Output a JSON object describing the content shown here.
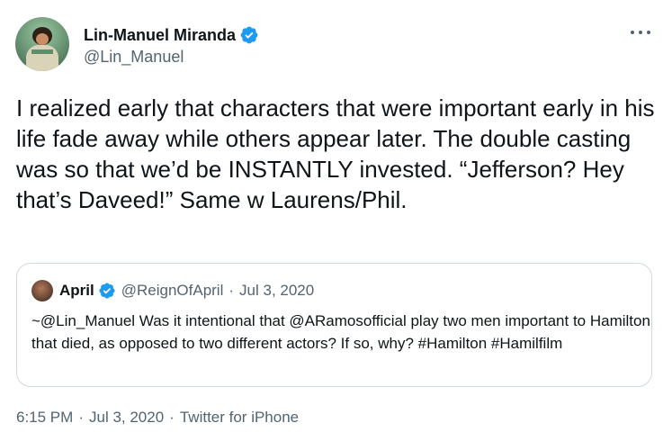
{
  "author": {
    "display_name": "Lin-Manuel Miranda",
    "handle": "@Lin_Manuel",
    "verified_icon": "verified-badge-icon"
  },
  "tweet": {
    "text": "I realized early that characters that were important early in his life fade away while others appear later. The double casting was so that we’d be INSTANTLY invested. “Jefferson? Hey that’s Daveed!” Same w Laurens/Phil."
  },
  "quoted_tweet": {
    "display_name": "April",
    "handle": "@ReignOfApril",
    "separator": "·",
    "date": "Jul 3, 2020",
    "text": "~@Lin_Manuel Was it intentional that @ARamosofficial play two men important to Hamilton that died, as opposed to two different actors? If so, why? #Hamilton #Hamilfilm"
  },
  "meta": {
    "time": "6:15 PM",
    "separator": "·",
    "date": "Jul 3, 2020",
    "source": "Twitter for iPhone"
  },
  "colors": {
    "verified_blue": "#1d9bf0",
    "text_primary": "#0f1419",
    "text_secondary": "#536471",
    "border": "#cfd9de"
  }
}
